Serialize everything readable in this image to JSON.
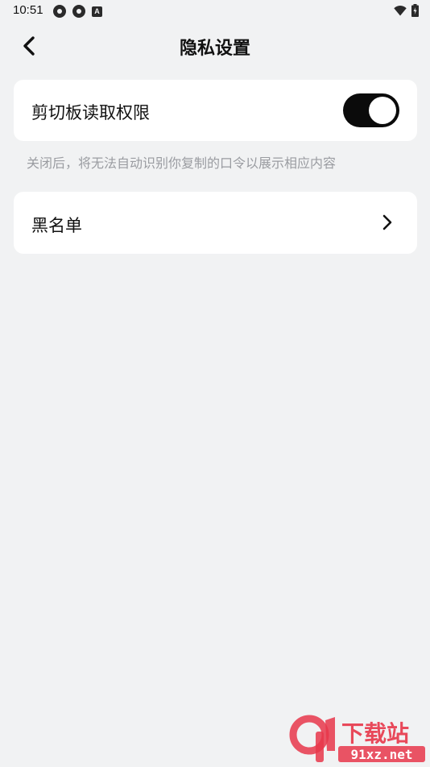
{
  "status_bar": {
    "time": "10:51",
    "left_icons": [
      "app-notification-icon",
      "app-notification-icon",
      "a-icon"
    ],
    "a_label": "A",
    "right_icons": [
      "wifi-icon",
      "battery-icon"
    ]
  },
  "header": {
    "title": "隐私设置",
    "back_icon": "chevron-left-icon"
  },
  "settings": {
    "clipboard": {
      "label": "剪切板读取权限",
      "enabled": true,
      "hint": "关闭后，将无法自动识别你复制的口令以展示相应内容"
    },
    "blacklist": {
      "label": "黑名单",
      "icon": "chevron-right-icon"
    }
  },
  "watermark": {
    "text_top": "下载站",
    "text_bottom": "91xz.net"
  },
  "colors": {
    "background": "#f1f2f3",
    "card": "#ffffff",
    "toggle_on": "#0b0b0b",
    "hint_text": "#9a9ca1",
    "watermark_red": "#e8374a"
  }
}
